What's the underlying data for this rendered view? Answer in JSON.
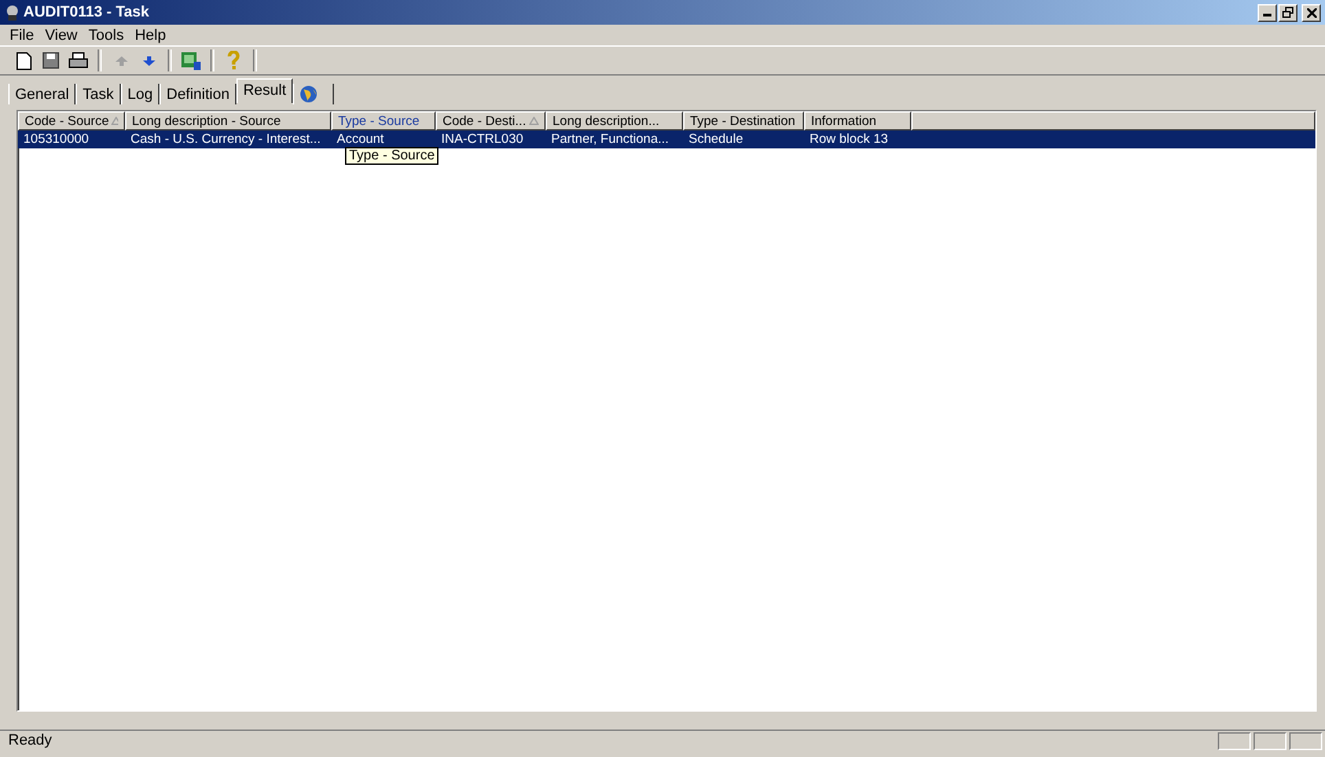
{
  "window": {
    "title": "AUDIT0113 - Task"
  },
  "menu": [
    {
      "label": "File"
    },
    {
      "label": "View"
    },
    {
      "label": "Tools"
    },
    {
      "label": "Help"
    }
  ],
  "tabs": [
    {
      "label": "General",
      "selected": false
    },
    {
      "label": "Task",
      "selected": false
    },
    {
      "label": "Log",
      "selected": false
    },
    {
      "label": "Definition",
      "selected": false
    },
    {
      "label": "Result",
      "selected": true
    },
    {
      "kind": "globe",
      "selected": false
    }
  ],
  "table": {
    "columns": [
      {
        "label": "Code - Source",
        "sorted": true,
        "hovered": false
      },
      {
        "label": "Long description - Source",
        "sorted": false,
        "hovered": false
      },
      {
        "label": "Type - Source",
        "sorted": false,
        "hovered": true
      },
      {
        "label": "Code - Desti...",
        "sorted": true,
        "hovered": false
      },
      {
        "label": "Long description...",
        "sorted": false,
        "hovered": false
      },
      {
        "label": "Type - Destination",
        "sorted": false,
        "hovered": false
      },
      {
        "label": "Information",
        "sorted": false,
        "hovered": false
      }
    ],
    "rows": [
      {
        "selected": true,
        "cells": [
          "105310000",
          "Cash - U.S. Currency - Interest...",
          "Account",
          "INA-CTRL030",
          "Partner, Functiona...",
          "Schedule",
          "Row block 13"
        ]
      }
    ]
  },
  "tooltip": "Type - Source",
  "status_bar": "Ready"
}
